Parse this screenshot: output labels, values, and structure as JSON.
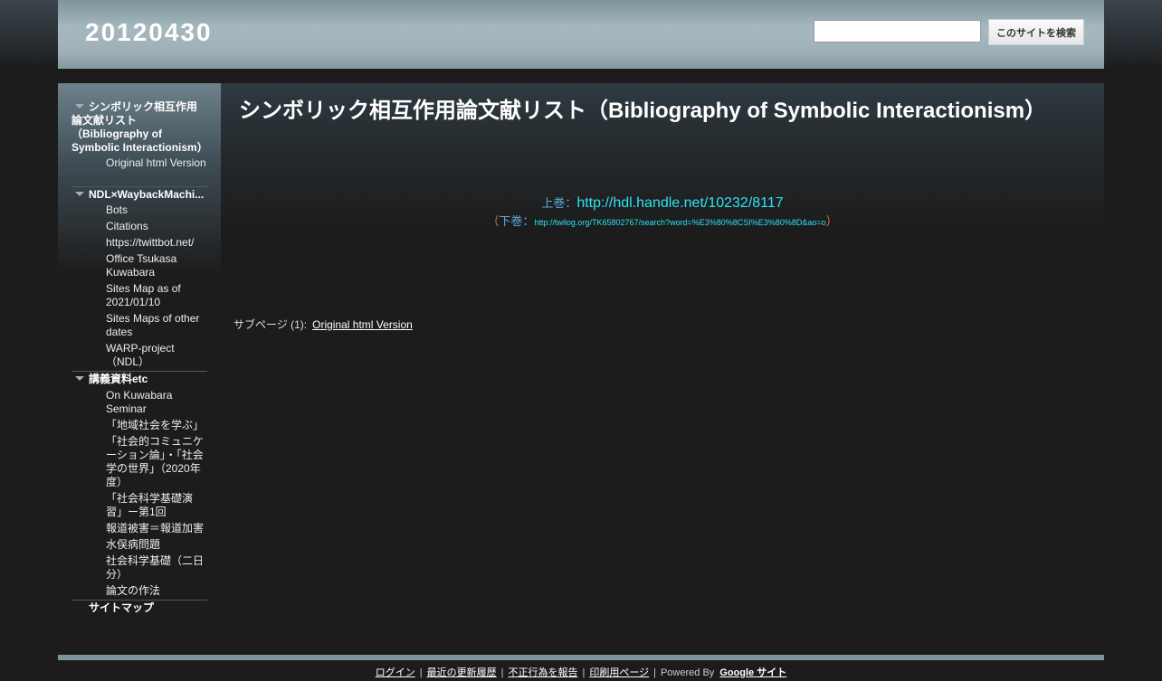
{
  "header": {
    "site_title": "20120430",
    "search_placeholder": "",
    "search_button": "このサイトを検索"
  },
  "sidebar": {
    "top_item": "シンボリック相互作用論文献リスト（Bibliography of Symbolic Interactionism）",
    "top_sub": [
      "Original html Version"
    ],
    "group1_title": "NDL×WaybackMachi...",
    "group1_items": [
      "Bots",
      "Citations",
      "https://twittbot.net/",
      "Office Tsukasa Kuwabara",
      "Sites Map as of 2021/01/10",
      "Sites Maps of other dates",
      "WARP-project（NDL）"
    ],
    "group2_title": "講義資料etc",
    "group2_items": [
      "On Kuwabara Seminar",
      "「地域社会を学ぶ」",
      "「社会的コミュニケーション論」・「社会学の世界」（2020年度）",
      "「社会科学基礎演習」ー第1回",
      "報道被害＝報道加害",
      "水俣病問題",
      "社会科学基礎（二日分）",
      "論文の作法"
    ],
    "sitemap": "サイトマップ"
  },
  "main": {
    "title": "シンボリック相互作用論文献リスト（Bibliography of Symbolic Interactionism）",
    "vol1_label": "上巻：",
    "vol1_link": "http://hdl.handle.net/10232/8117",
    "vol2_open": "（",
    "vol2_label": "下巻：",
    "vol2_link": "http://twilog.org/TK65802767/search?word=%E3%80%8CSI%E3%80%8D&ao=o",
    "vol2_close": "）",
    "subpages_label": "サブページ (1):",
    "subpages_link": "Original html Version"
  },
  "footer": {
    "login": "ログイン",
    "recent": "最近の更新履歴",
    "report": "不正行為を報告",
    "print": "印刷用ページ",
    "powered": "Powered By",
    "google": "Google サイト"
  },
  "colors": {
    "background": "#1c1c1c",
    "header": "#a6b8bf",
    "link_cyan": "#2be3f0",
    "label_blue": "#5aa8d8",
    "paren_orange": "#d87a2a"
  }
}
